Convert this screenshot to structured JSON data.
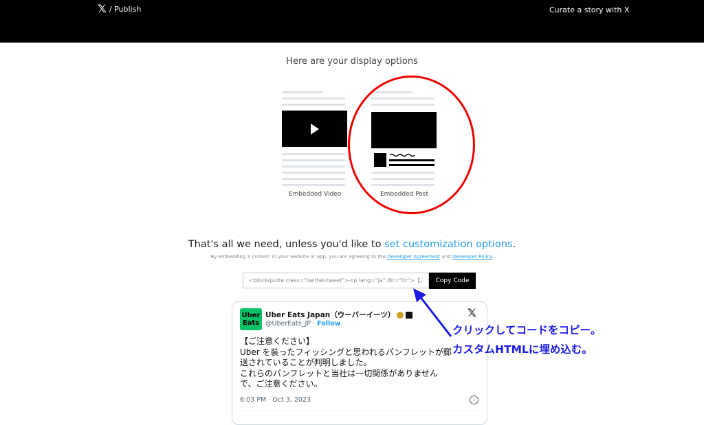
{
  "header": {
    "brand_logo": "𝕏",
    "brand_label": "/ Publish",
    "curate_label": "Curate a story with X"
  },
  "options": {
    "heading": "Here are your display options",
    "video_label": "Embedded Video",
    "post_label": "Embedded Post"
  },
  "customize": {
    "prefix": "That's all we need, unless you'd like to",
    "link": "set customization options",
    "suffix": ".",
    "agree_prefix": "By embedding X content in your website or app, you are agreeing to the",
    "dev_agreement": "Developer Agreement",
    "and": "and",
    "dev_policy": "Developer Policy",
    "agree_suffix": "."
  },
  "code": {
    "value": "<blockquote class=\"twitter-tweet\"><p lang=\"ja\" dir=\"ltr\">【ご注",
    "copy_label": "Copy Code"
  },
  "tweet": {
    "avatar_line1": "Uber",
    "avatar_line2": "Eats",
    "name": "Uber Eats Japan（ウーバーイーツ）",
    "handle": "@UberEats_JP",
    "dot": "·",
    "follow": "Follow",
    "logo": "𝕏",
    "lines": [
      "【ご注意ください】",
      "Uber を装ったフィッシングと思われるパンフレットが郵",
      "送されていることが判明しました。",
      "これらのパンフレットと当社は一切関係がありません",
      "で、ご注意ください。"
    ],
    "timestamp": "6:03 PM · Oct 3, 2023",
    "info": "i"
  },
  "annotation": {
    "line1": "クリックしてコードをコピー。",
    "line2": "カスタムHTMLに埋め込む。"
  },
  "colors": {
    "accent": "#1d9bf0",
    "annotation": "#1a1ae6",
    "highlight_ring": "#e00000",
    "uber_green": "#06c167"
  }
}
